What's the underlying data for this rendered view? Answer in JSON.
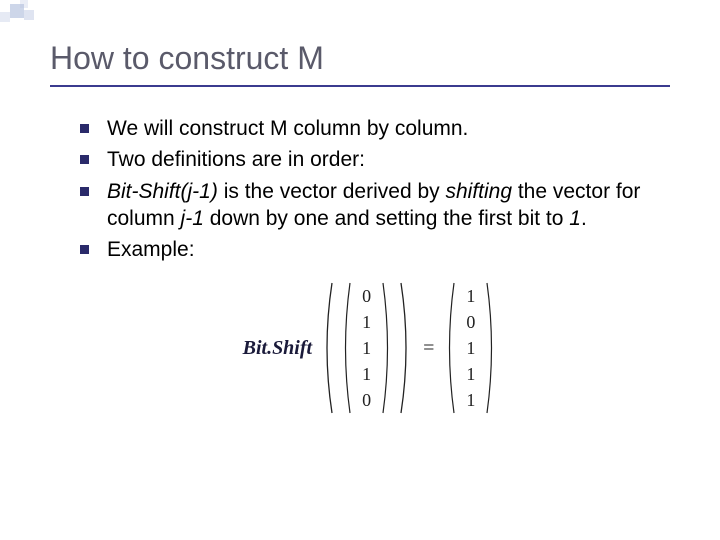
{
  "title": "How to construct M",
  "bullets": {
    "b0": "We will construct M column by column.",
    "b1": "Two definitions are in order:",
    "b2_pre": "Bit-Shift(j-1)",
    "b2_mid": " is the vector derived by ",
    "b2_em": "shifting",
    "b2_post1": " the vector for column ",
    "b2_j": "j-1",
    "b2_post2": " down by one and setting the first bit to ",
    "b2_one": "1",
    "b2_end": ".",
    "b3": "Example:"
  },
  "formula": {
    "label": "Bit.Shift",
    "eq": "=",
    "input": [
      "0",
      "1",
      "1",
      "1",
      "0"
    ],
    "output": [
      "1",
      "0",
      "1",
      "1",
      "1"
    ]
  }
}
